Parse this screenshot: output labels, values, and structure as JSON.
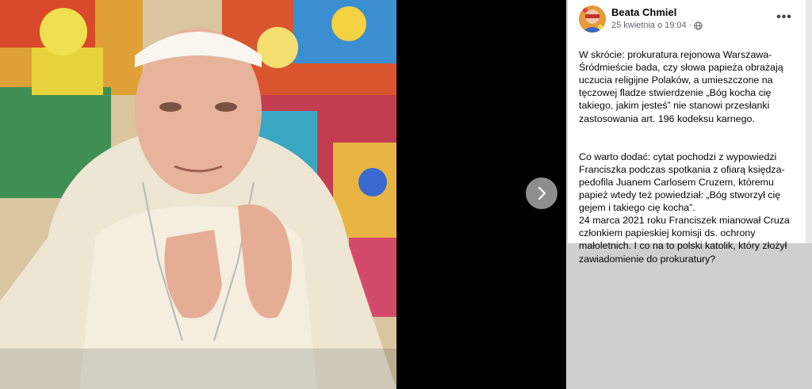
{
  "post": {
    "author": "Beata Chmiel",
    "date": "25 kwietnia o 19:04",
    "separator": "·",
    "privacy_icon": "globe-icon",
    "more_label": "•••",
    "paragraph1": "W skrócie: prokuratura rejonowa Warszawa-Śródmieście bada, czy słowa papieża obrażają uczucia religijne Polaków, a umieszczone na tęczowej fladze stwierdzenie „Bóg kocha cię takiego, jakim jesteś” nie stanowi przesłanki zastosowania art. 196 kodeksu karnego.",
    "paragraph2": "Co warto dodać: cytat pochodzi z wypowiedzi Franciszka podczas spotkania z ofiarą księdza-pedofila Juanem Carlosem Cruzem, któremu papież wtedy też powiedział: „Bóg stworzył cię gejem i takiego cię kocha”.\n24 marca 2021 roku Franciszek mianował Cruza członkiem papieskiej komisji ds. ochrony małoletnich. I co na to polski katolik, który złożył zawiadomienie do prokuratury?"
  },
  "viewer": {
    "next_icon": "chevron-right-icon"
  },
  "colors": {
    "viewer_bg": "#000000",
    "panel_bg": "#ffffff",
    "secondary_text": "#65676b"
  }
}
